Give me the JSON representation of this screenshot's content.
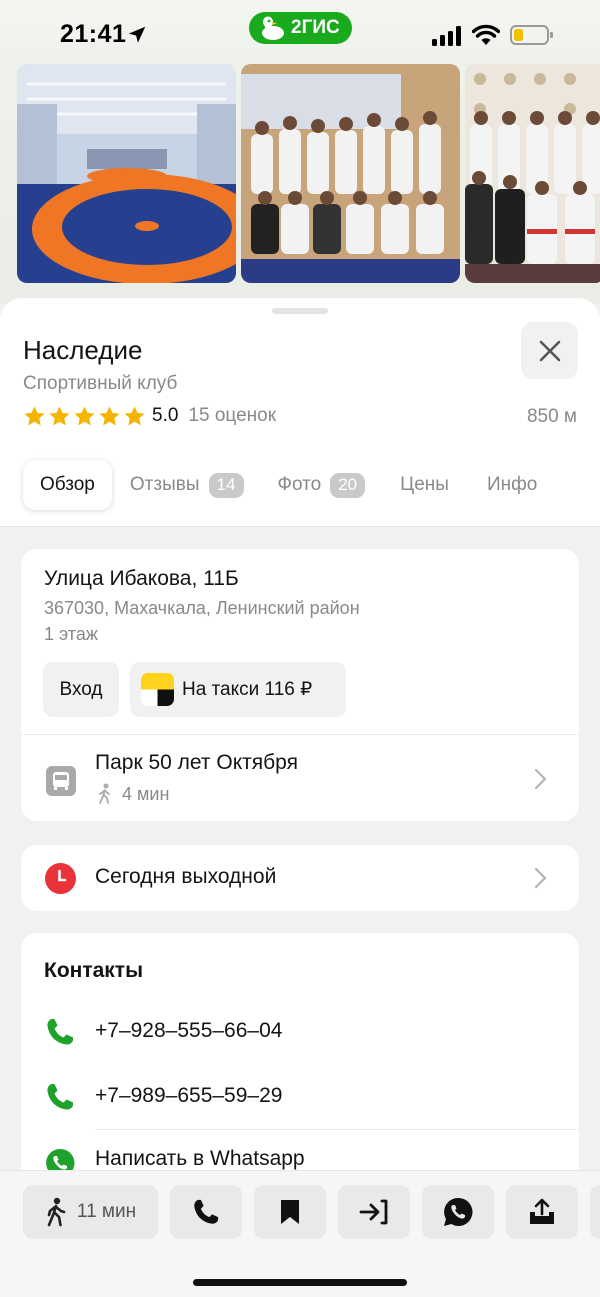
{
  "status_bar": {
    "time": "21:41",
    "brand": "2ГИС",
    "icons": [
      "location-arrow-icon",
      "signal-icon",
      "wifi-icon",
      "battery-icon"
    ]
  },
  "photos": [
    "wrestling-hall-photo",
    "team-group-photo",
    "award-group-photo"
  ],
  "place": {
    "title": "Наследие",
    "subtitle": "Спортивный клуб",
    "rating_value": "5.0",
    "stars": 5,
    "rating_count": "15 оценок",
    "distance": "850 м"
  },
  "tabs": [
    {
      "label": "Обзор",
      "badge": null,
      "active": true
    },
    {
      "label": "Отзывы",
      "badge": "14",
      "active": false
    },
    {
      "label": "Фото",
      "badge": "20",
      "active": false
    },
    {
      "label": "Цены",
      "badge": null,
      "active": false
    },
    {
      "label": "Инфо",
      "badge": null,
      "active": false
    }
  ],
  "address": {
    "street": "Улица Ибакова, 11Б",
    "city": "367030, Махачкала, Ленинский район",
    "floor": "1 этаж",
    "entrance_label": "Вход",
    "taxi_label": "На такси 116 ₽"
  },
  "transit": {
    "stop_name": "Парк 50 лет Октября",
    "walk_time": "4 мин"
  },
  "hours": {
    "text": "Сегодня выходной"
  },
  "contacts": {
    "title": "Контакты",
    "phones": [
      "+7‒928‒555‒66‒04",
      "+7‒989‒655‒59‒29"
    ],
    "whatsapp": "Написать в Whatsapp"
  },
  "action_bar": {
    "walk_label": "11 мин"
  },
  "colors": {
    "brand_green": "#19aa1e",
    "star_yellow": "#f5b400",
    "phone_green": "#1fa22b",
    "clock_red": "#e8333a",
    "text_primary": "#141414",
    "text_secondary": "#898989"
  }
}
